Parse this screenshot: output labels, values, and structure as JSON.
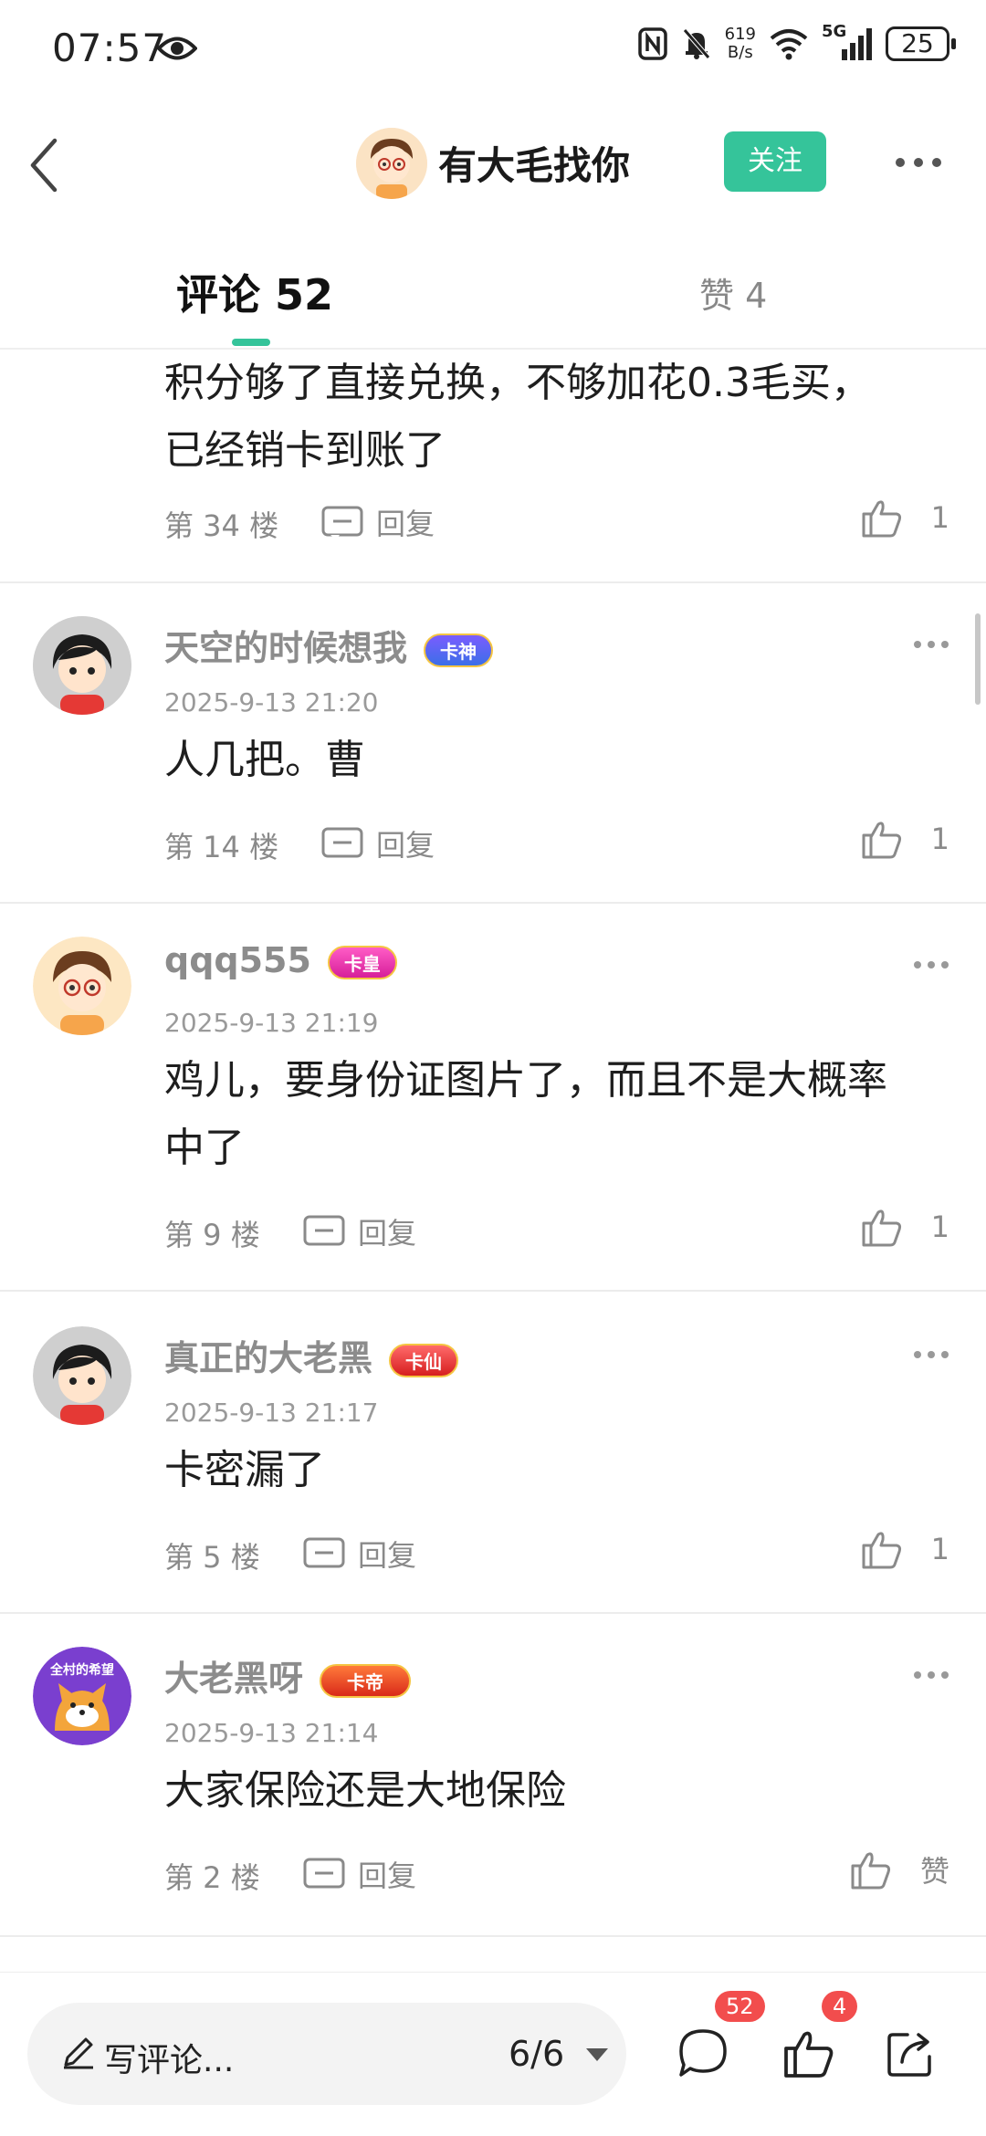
{
  "status_bar": {
    "time": "07:57",
    "net_speed_value": "619",
    "net_speed_unit": "B/s",
    "network": "5G",
    "battery": "25"
  },
  "header": {
    "username": "有大毛找你",
    "follow_label": "关注"
  },
  "tabs": {
    "comments_label": "评论 52",
    "likes_label": "赞 4"
  },
  "reply_label": "回复",
  "comments": [
    {
      "text": "积分够了直接兑换，不够加花0.3毛买，\n已经销卡到账了",
      "floor": "第 34 楼",
      "likes": "1"
    },
    {
      "username": "天空的时候想我",
      "badge": "卡神",
      "time": "2025-9-13 21:20",
      "text": "人几把。曹",
      "floor": "第 14 楼",
      "likes": "1"
    },
    {
      "username": "qqq555",
      "badge": "卡皇",
      "time": "2025-9-13 21:19",
      "text": "鸡儿，要身份证图片了，而且不是大概率\n中了",
      "floor": "第 9 楼",
      "likes": "1"
    },
    {
      "username": "真正的大老黑",
      "badge": "卡仙",
      "time": "2025-9-13 21:17",
      "text": "卡密漏了",
      "floor": "第 5 楼",
      "likes": "1"
    },
    {
      "username": "大老黑呀",
      "badge": "卡帝",
      "time": "2025-9-13 21:14",
      "text": "大家保险还是大地保险",
      "floor": "第 2 楼",
      "likes": "赞"
    }
  ],
  "avatar_text": "全村的希望",
  "bottom_bar": {
    "placeholder": "写评论...",
    "page_indicator": "6/6",
    "comment_count": "52",
    "like_count": "4"
  },
  "colors": {
    "accent": "#35c49a",
    "badge_red": "#f24d4d"
  }
}
